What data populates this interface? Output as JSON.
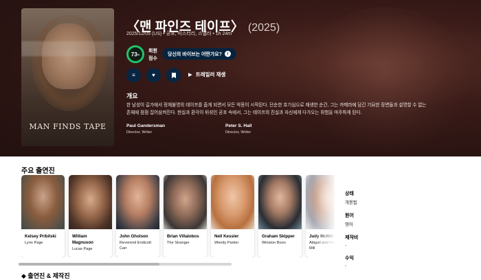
{
  "movie": {
    "title": "〈맨 파인즈 테이프〉",
    "year": "(2025)",
    "facts": "2025/12/05 (US)  •  공포, 미스터리, 스릴러  •  1h 24m",
    "poster_title": "MAN FINDS TAPE",
    "score": "73",
    "score_unit": "%",
    "score_label_1": "회원",
    "score_label_2": "점수",
    "vibe_label": "당신의 바이브는 어떤가요?",
    "trailer_label": "트레일러 재생",
    "overview_heading": "개요",
    "overview": "한 남성이 길가에서 정체불명의 테이프를 줍게 되면서 모든 악몽이 시작된다. 단순한 호기심으로 재생한 순간, 그는 카메라에 담긴 기묘한 장면들과 설명할 수 없는 존재에 점점 집어삼켜진다. 현실과 환각이 뒤섞인 공포 속에서, 그는 테이프의 진실과 자신에게 다가오는 위험을 마주하게 된다.",
    "crew": [
      {
        "name": "Paul Gandersman",
        "role": "Director, Writer"
      },
      {
        "name": "Peter S. Hall",
        "role": "Director, Writer"
      }
    ]
  },
  "cast_section": {
    "heading": "주요 출연진",
    "members": [
      {
        "name": "Kelsey Pribilski",
        "character": "Lynn Page"
      },
      {
        "name": "William Magnuson",
        "character": "Lucas Page"
      },
      {
        "name": "John Gholson",
        "character": "Reverend Endicott Carr"
      },
      {
        "name": "Brian Villalobos",
        "character": "The Stranger"
      },
      {
        "name": "Nell Kessler",
        "character": "Wendy Parker"
      },
      {
        "name": "Graham Skipper",
        "character": "Winston Boon"
      },
      {
        "name": "Judy McMill",
        "character": "Abigail and Fernette Mill"
      }
    ]
  },
  "next_heading": "◆ 출연진 & 제작진",
  "side_facts": [
    {
      "label": "상태",
      "value": "개봉됨"
    },
    {
      "label": "원어",
      "value": "영어"
    },
    {
      "label": "제작비",
      "value": "-"
    },
    {
      "label": "수익",
      "value": "-"
    }
  ],
  "colors": {
    "hero_bg": "#2a1412",
    "score_ring": "#22c26b",
    "button_bg": "#082541"
  },
  "icons": {
    "list": "list-icon",
    "favorite": "heart-icon",
    "watchlist": "bookmark-icon",
    "play": "play-icon",
    "info": "info-icon"
  }
}
